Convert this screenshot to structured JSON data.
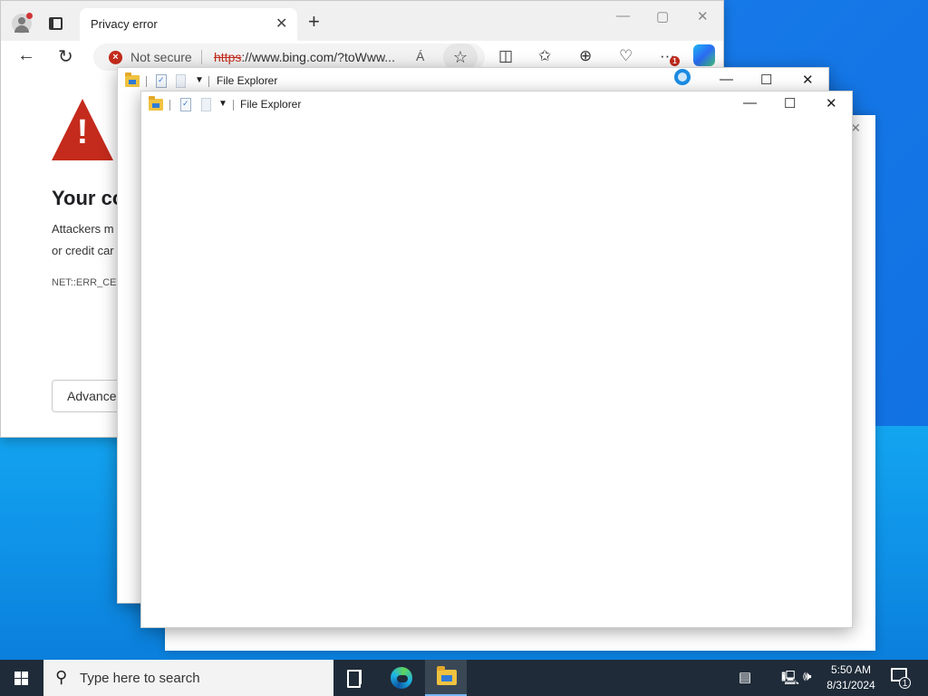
{
  "browser": {
    "tab_title": "Privacy error",
    "tab_close": "✕",
    "new_tab": "+",
    "window_controls": {
      "minimize": "—",
      "maximize": "▢",
      "close": "✕"
    },
    "security_status": "Not secure",
    "url_scheme": "https",
    "url_rest": "://www.bing.com/?toWww...",
    "read_aloud": "Á",
    "notification_badge": "1"
  },
  "error_page": {
    "heading": "Your co",
    "line1": "Attackers m",
    "line2": "or credit car",
    "error_code": "NET::ERR_CER",
    "advanced_button": "Advanced"
  },
  "explorer_back": {
    "title": "File Explorer",
    "controls": {
      "minimize": "—",
      "maximize": "☐",
      "close": "✕"
    }
  },
  "explorer_front": {
    "title": "File Explorer",
    "controls": {
      "minimize": "—",
      "maximize": "☐",
      "close": "✕"
    }
  },
  "taskbar": {
    "search_placeholder": "Type here to search",
    "time": "5:50 AM",
    "date": "8/31/2024",
    "notification_count": "1"
  },
  "colors": {
    "accent": "#0078d4",
    "error_red": "#c42b1c",
    "taskbar": "#1f2b38",
    "desktop": "#0a5fd6"
  }
}
